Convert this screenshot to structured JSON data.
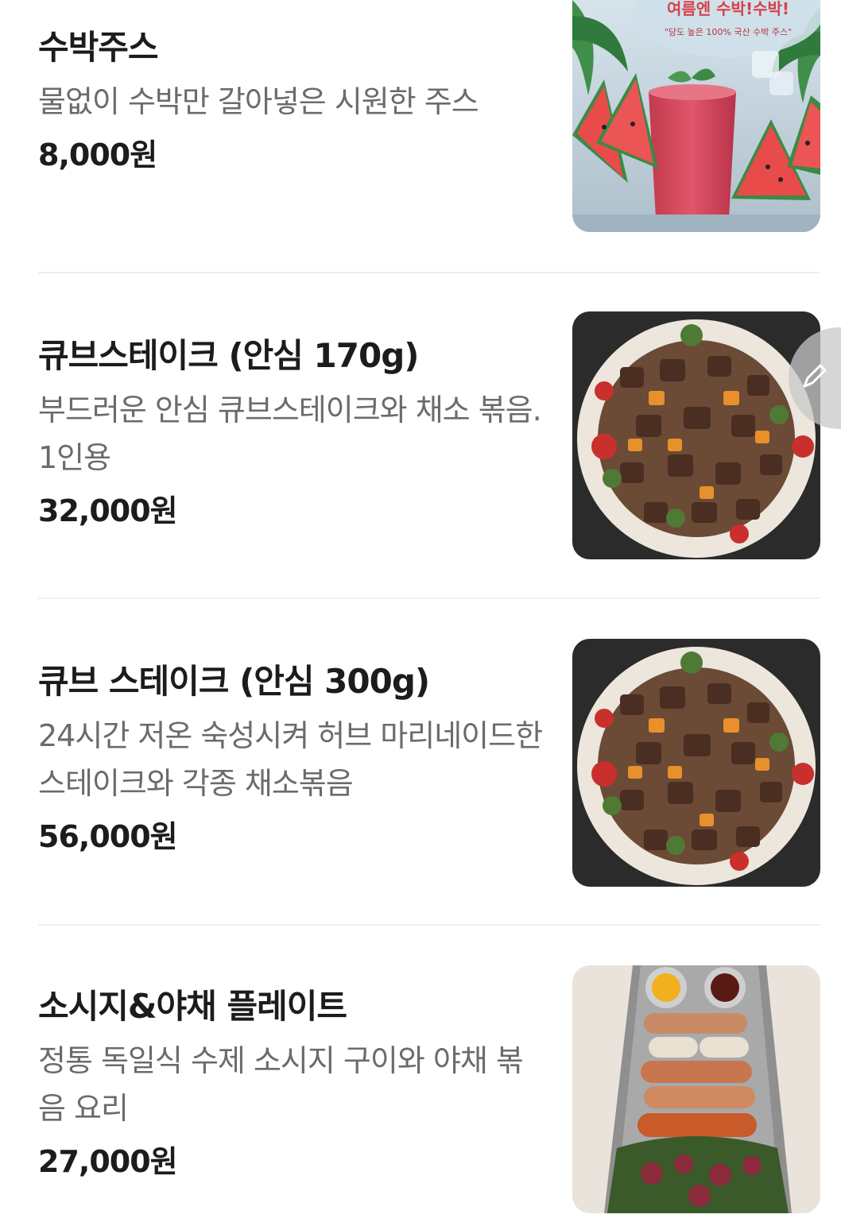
{
  "menu": {
    "items": [
      {
        "name": "수박주스",
        "description": "물없이 수박만 갈아넣은 시원한 주스",
        "price": "8,000원",
        "image_banner_title": "여름엔 수박!수박!",
        "image_banner_sub": "\"당도 높은 100% 국산 수박 주스\""
      },
      {
        "name": "큐브스테이크 (안심 170g)",
        "description": "부드러운 안심 큐브스테이크와 채소 볶음. 1인용",
        "price": "32,000원"
      },
      {
        "name": "큐브 스테이크 (안심 300g)",
        "description": "24시간 저온 숙성시켜 허브 마리네이드한 스테이크와 각종 채소볶음",
        "price": "56,000원"
      },
      {
        "name": "소시지&야채 플레이트",
        "description": "정통 독일식 수제 소시지 구이와 야채 볶음 요리",
        "price": "27,000원"
      }
    ]
  },
  "icons": {
    "edit_fab": "pencil-icon"
  }
}
